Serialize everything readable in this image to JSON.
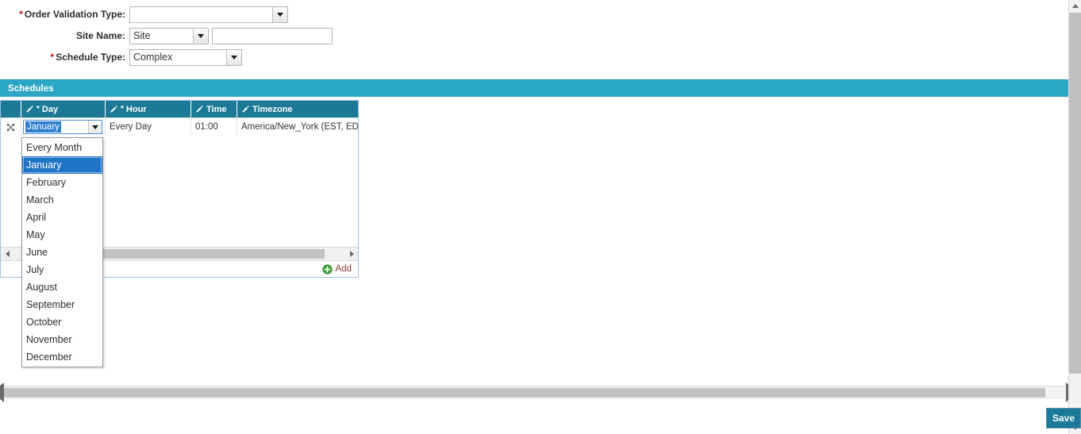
{
  "form": {
    "fields": [
      {
        "label": "Order Validation Type:",
        "required": true,
        "value": "",
        "control": "select"
      },
      {
        "label": "Site Name:",
        "required": false,
        "value": "Site",
        "control": "select-plus-text",
        "text_value": ""
      },
      {
        "label": "Schedule Type:",
        "required": true,
        "value": "Complex",
        "control": "select"
      }
    ],
    "required_marker": "*"
  },
  "schedules_panel": {
    "title": "Schedules",
    "columns": [
      {
        "label": "Day",
        "required": true,
        "editable": true
      },
      {
        "label": "Hour",
        "required": true,
        "editable": true
      },
      {
        "label": "Time",
        "required": false,
        "editable": true
      },
      {
        "label": "Timezone",
        "required": false,
        "editable": true
      }
    ],
    "rows": [
      {
        "day": "January",
        "hour": "Every Day",
        "time": "01:00",
        "timezone": "America/New_York (EST, EDT)"
      }
    ],
    "add_label": "Add"
  },
  "day_dropdown": {
    "open": true,
    "selected": "January",
    "options": [
      "Every Month",
      "January",
      "February",
      "March",
      "April",
      "May",
      "June",
      "July",
      "August",
      "September",
      "October",
      "November",
      "December"
    ]
  },
  "footer": {
    "save_label": "Save"
  },
  "colors": {
    "panel_header": "#2ba6c5",
    "grid_header": "#1c7a96",
    "required_star": "#b81414",
    "selection_blue": "#1f74c8",
    "save_button": "#1b7a99",
    "add_icon_green": "#3fa535",
    "add_text": "#8a3b2e"
  }
}
